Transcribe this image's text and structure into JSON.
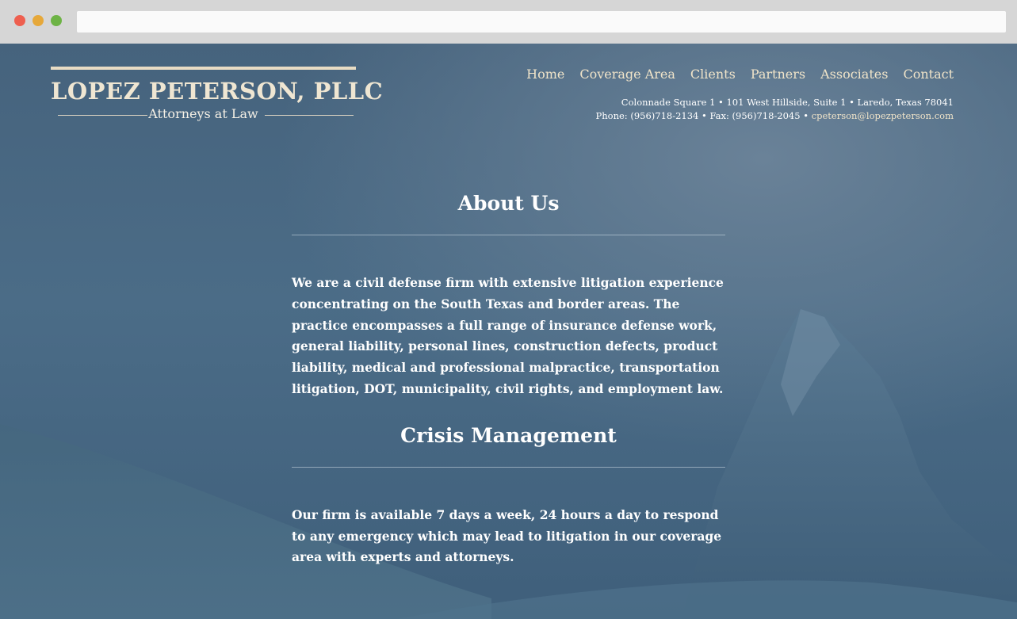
{
  "browser": {
    "address": ""
  },
  "logo": {
    "title": "LOPEZ PETERSON, PLLC",
    "subtitle": "Attorneys at Law"
  },
  "nav": {
    "items": [
      "Home",
      "Coverage Area",
      "Clients",
      "Partners",
      "Associates",
      "Contact"
    ]
  },
  "contact": {
    "address_line": "Colonnade Square 1 • 101 West Hillside, Suite 1 • Laredo, Texas 78041",
    "phone_fax": "Phone: (956)718-2134 • Fax: (956)718-2045 • ",
    "email": "cpeterson@lopezpeterson.com"
  },
  "about": {
    "heading": "About Us",
    "body": "We are a civil defense firm with extensive litigation experience concentrating on the South Texas and border areas. The practice encompasses a full range of insurance defense work, general liability, personal lines, construction defects, product liability, medical and professional malpractice, transportation litigation, DOT, municipality, civil rights, and employment law."
  },
  "crisis": {
    "heading": "Crisis Management",
    "body": "Our firm is available 7 days a week, 24 hours a day to respond to any emergency which may lead to litigation in our coverage area with experts and attorneys."
  },
  "colors": {
    "background": "#4a6a85",
    "accent": "#f0e4c9",
    "text": "#ffffff"
  }
}
